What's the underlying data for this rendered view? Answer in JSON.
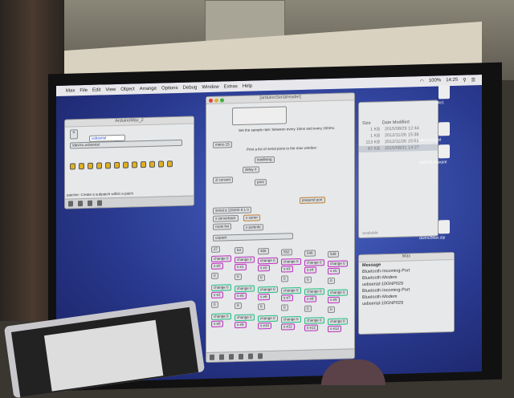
{
  "menubar": {
    "items": [
      "Max",
      "File",
      "Edit",
      "View",
      "Object",
      "Arrange",
      "Options",
      "Debug",
      "Window",
      "Extras",
      "Help"
    ],
    "battery": "100%",
    "time": "14:25"
  },
  "small_patch": {
    "title": "ArduinoMax_2",
    "status": "patcher: Create a subpatch within a patch"
  },
  "main_patch": {
    "title": "[arduinoSerialreader]",
    "comment1": "Set the sample rate: between every 15ms and every 100ms.",
    "comment2": "Print a list of serial ports to the max window:",
    "objects": {
      "metro": "metro 15",
      "delay": "delay 4",
      "loadbang": "loadbang",
      "print": "print",
      "convert": "zl convert",
      "prepend": "prepend port",
      "serial": "serial a 115200 8 1 0",
      "serverback": "s serverback",
      "sorter": "s sorter",
      "route": "route list",
      "portinfo": "s portinfo",
      "unpack": "unpack",
      "num": "0"
    },
    "columns": [
      {
        "top": "27",
        "sends": [
          "s e0",
          "s e2",
          "s e8"
        ]
      },
      {
        "top": "63",
        "sends": [
          "s e1",
          "s e5",
          "s e9"
        ]
      },
      {
        "top": "466",
        "sends": [
          "s e2",
          "s e6",
          "s e10"
        ]
      },
      {
        "top": "552",
        "sends": [
          "s e3",
          "s e7",
          "s e11"
        ]
      },
      {
        "top": "546",
        "sends": [
          "s e4",
          "s e8",
          "s e12"
        ]
      },
      {
        "top": "538",
        "sends": [
          "s e5",
          "s e9",
          "s e13"
        ]
      }
    ],
    "change_label": "change 0"
  },
  "finder": {
    "col_size": "Size",
    "col_date": "Date Modified",
    "rows": [
      {
        "size": "1 KB",
        "date": "2015/08/29 12:44"
      },
      {
        "size": "1 KB",
        "date": "2012/11/26 15:38"
      },
      {
        "size": "113 KB",
        "date": "2012/11/26 15:51"
      },
      {
        "size": "87 KB",
        "date": "2015/08/31 14:27"
      }
    ],
    "available": "available"
  },
  "max_window": {
    "title": "Max",
    "header": "Message",
    "lines": [
      "Bluetooth-Incoming-Port",
      "Bluetooth-Modem",
      "usbserial-10GNP029",
      "Bluetooth-Incoming-Port",
      "Bluetooth-Modem",
      "usbserial-10GNP029"
    ]
  },
  "desktop": {
    "icons": [
      "Air1",
      "ner.io.c2.pat",
      "hd2015.maxpat",
      "duino2Max.zip"
    ]
  }
}
